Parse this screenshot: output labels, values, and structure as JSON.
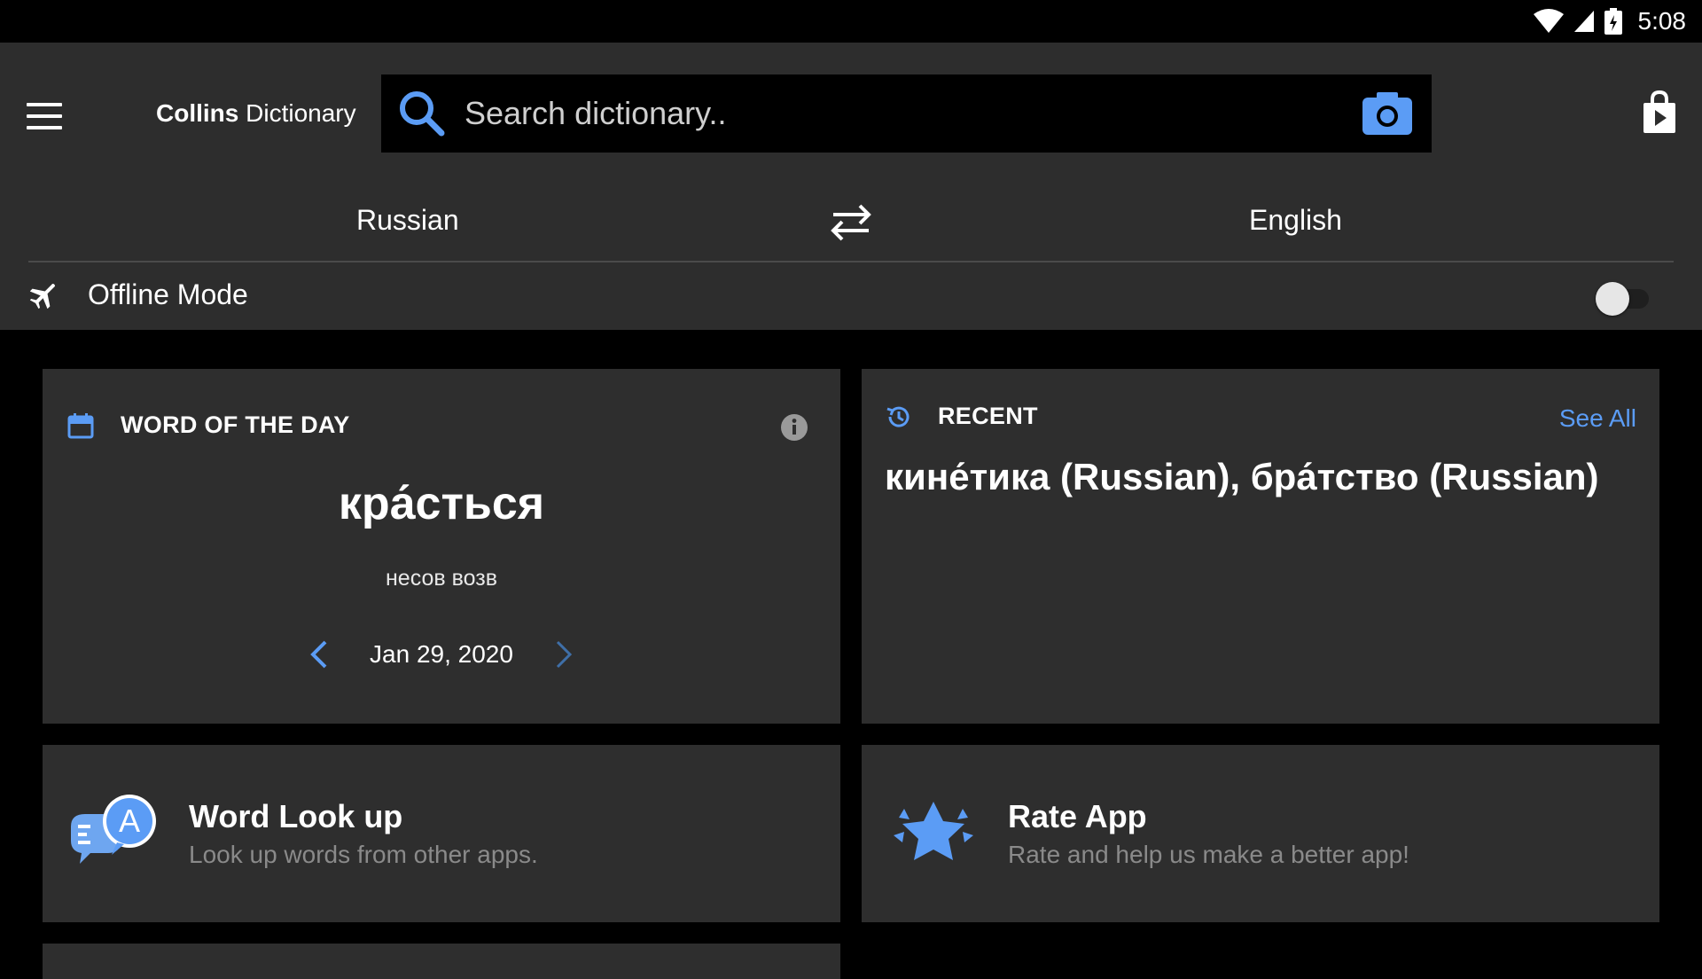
{
  "status_bar": {
    "time": "5:08"
  },
  "app_bar": {
    "brand_bold": "Collins",
    "brand_light": " Dictionary",
    "search_placeholder": "Search dictionary.."
  },
  "languages": {
    "from": "Russian",
    "to": "English"
  },
  "offline": {
    "label": "Offline Mode",
    "enabled": false
  },
  "word_of_the_day": {
    "title": "WORD OF THE DAY",
    "word": "кра́сться",
    "part_of_speech": "несов возв",
    "date": "Jan 29, 2020"
  },
  "recent": {
    "title": "RECENT",
    "see_all": "See All",
    "items": "кине́тика (Russian), бра́тство (Russian)"
  },
  "word_lookup": {
    "title": "Word Look up",
    "subtitle": "Look up words from other apps.",
    "icon_letter": "A"
  },
  "rate_app": {
    "title": "Rate App",
    "subtitle": "Rate and help us make a better app!"
  },
  "colors": {
    "accent": "#5b9cf5",
    "card_bg": "#2e2e2e",
    "appbar_bg": "#2d2d2d"
  }
}
